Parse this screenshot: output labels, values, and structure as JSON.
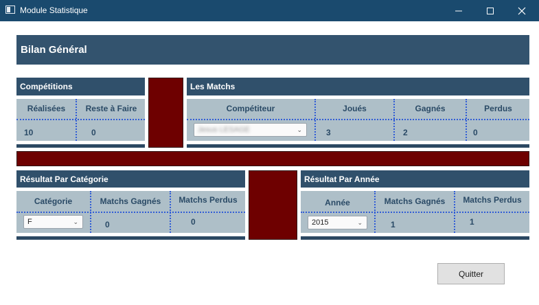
{
  "window": {
    "title": "Module Statistique"
  },
  "header": {
    "title": "Bilan Général"
  },
  "competitions": {
    "title": "Compétitions",
    "col_realisees": "Réalisées",
    "col_reste": "Reste à Faire",
    "realisees": "10",
    "reste": "0"
  },
  "matchs": {
    "title": "Les Matchs",
    "col_competiteur": "Compétiteur",
    "col_joues": "Joués",
    "col_gagnes": "Gagnés",
    "col_perdus": "Perdus",
    "competiteur_value": "Jesus LESAGE",
    "joues": "3",
    "gagnes": "2",
    "perdus": "0"
  },
  "categorie": {
    "title": "Résultat Par Catégorie",
    "col_categorie": "Catégorie",
    "col_gagnes": "Matchs Gagnés",
    "col_perdus": "Matchs Perdus",
    "categorie_value": "F",
    "gagnes": "0",
    "perdus": "0"
  },
  "annee": {
    "title": "Résultat Par Année",
    "col_annee": "Année",
    "col_gagnes": "Matchs Gagnés",
    "col_perdus": "Matchs Perdus",
    "annee_value": "2015",
    "gagnes": "1",
    "perdus": "1"
  },
  "buttons": {
    "quit": "Quitter"
  },
  "icons": {
    "app": "window-icon",
    "minimize": "minimize-icon",
    "maximize": "maximize-icon",
    "close": "close-icon",
    "dropdown": "chevron-down-icon"
  },
  "colors": {
    "titlebar": "#1a4a6e",
    "header": "#30506b",
    "panel": "#aebfc8",
    "accent_maroon": "#6e0000",
    "grid_dots": "#2f5bd6"
  }
}
